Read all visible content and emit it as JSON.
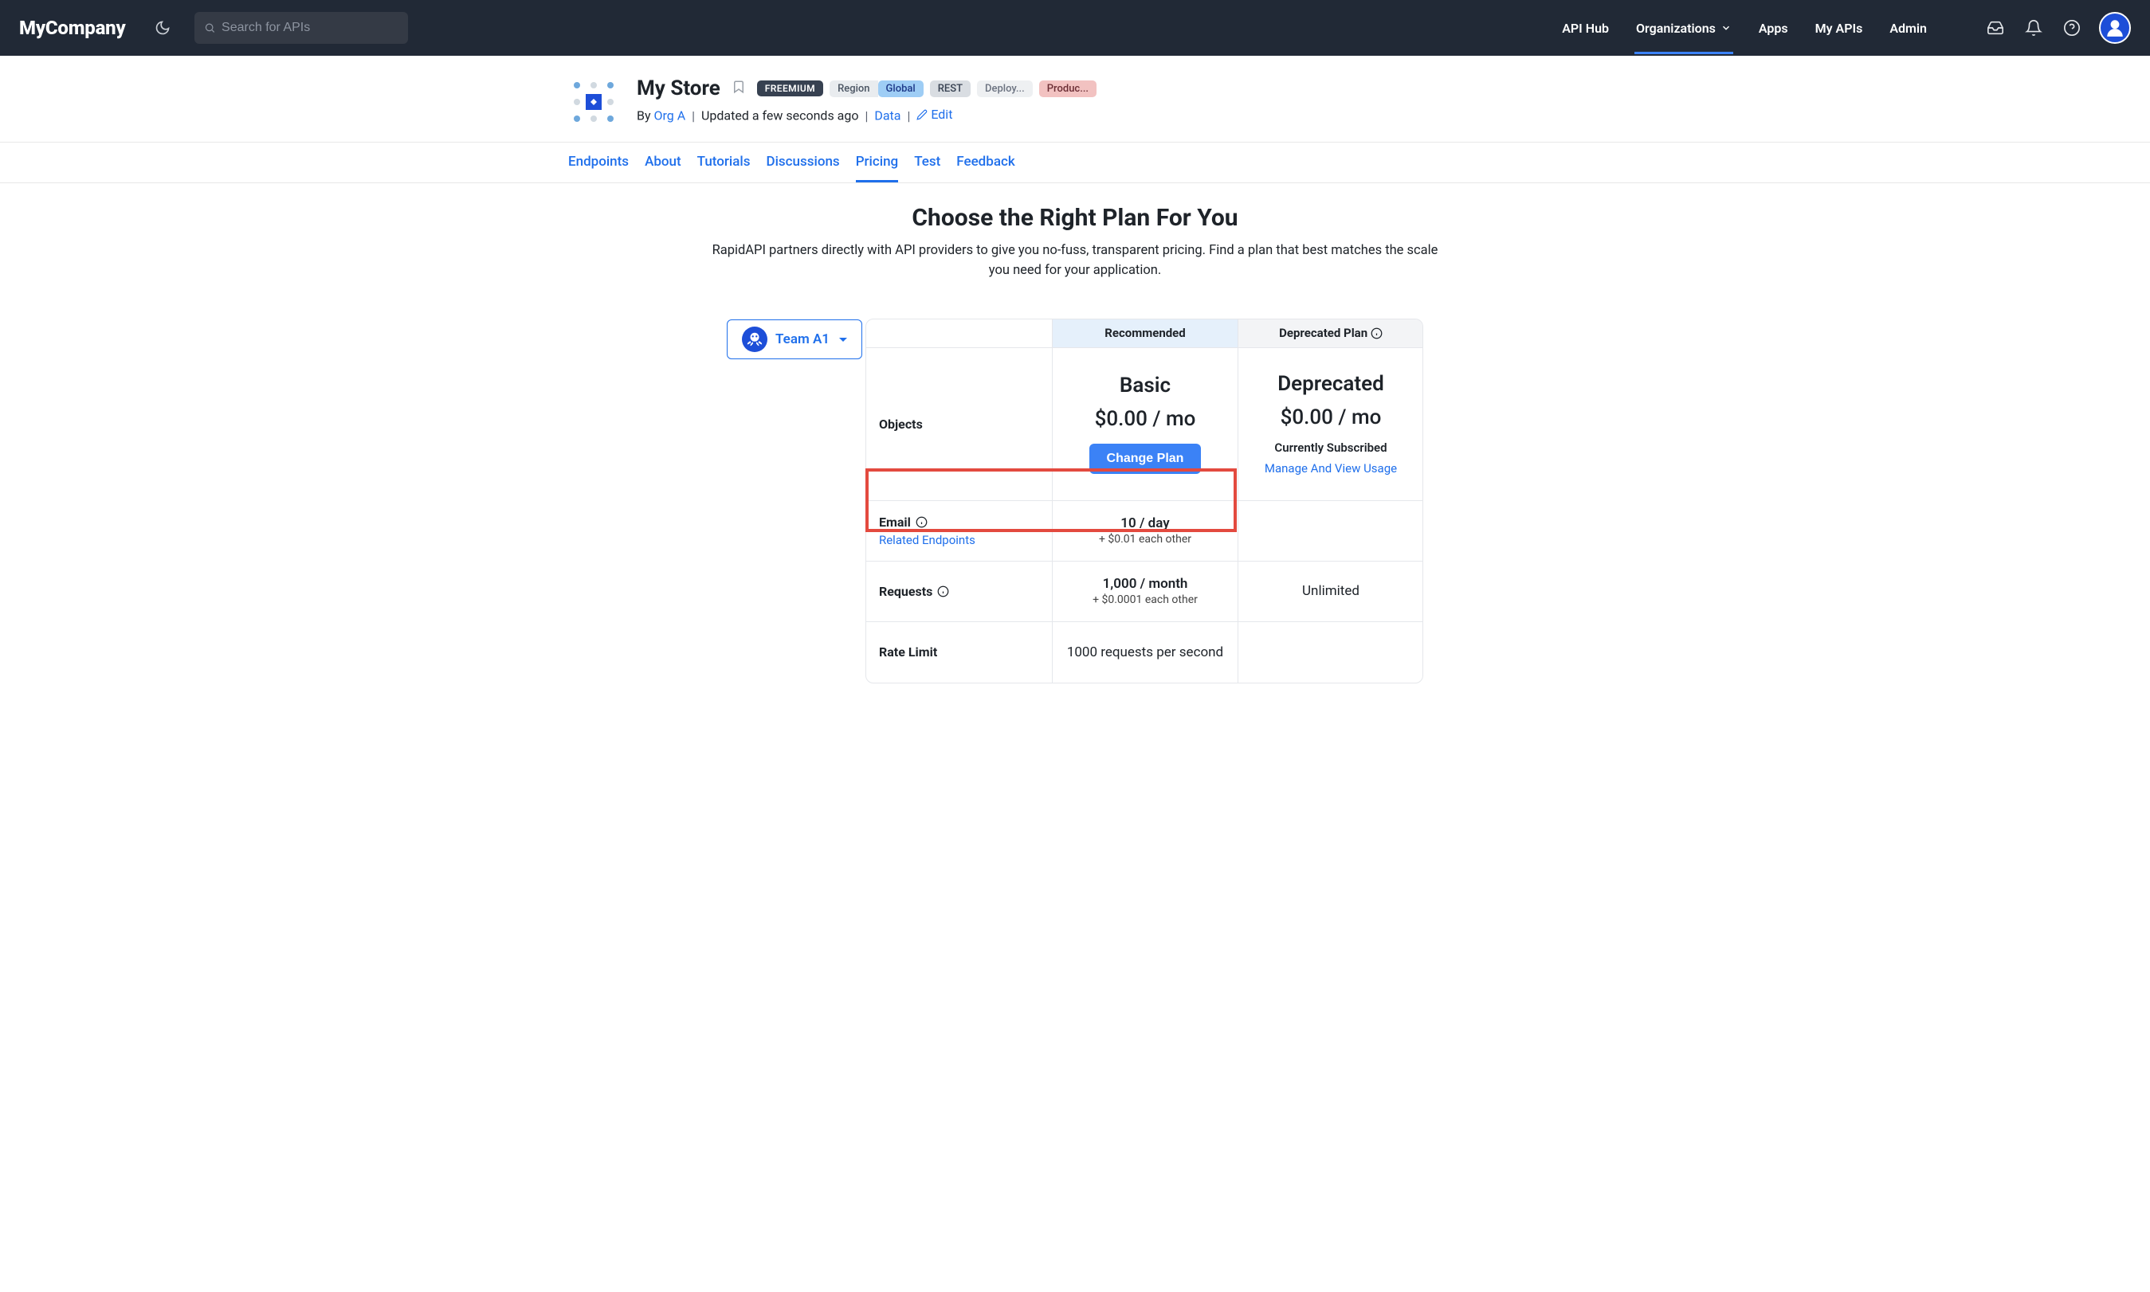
{
  "nav": {
    "brand": "MyCompany",
    "search_placeholder": "Search for APIs",
    "links": [
      "API Hub",
      "Organizations",
      "Apps",
      "My APIs",
      "Admin"
    ],
    "active_index": 1
  },
  "api": {
    "title": "My Store",
    "freemium_badge": "FREEMIUM",
    "region_label": "Region",
    "region_value": "Global",
    "rest_badge": "REST",
    "deploy_badge": "Deploy...",
    "produc_badge": "Produc...",
    "by_label": "By",
    "org_name": "Org A",
    "updated_text": "Updated a few seconds ago",
    "data_link": "Data",
    "edit_link": "Edit"
  },
  "tabs": {
    "items": [
      "Endpoints",
      "About",
      "Tutorials",
      "Discussions",
      "Pricing",
      "Test",
      "Feedback"
    ],
    "active_index": 4
  },
  "pricing": {
    "title": "Choose the Right Plan For You",
    "subtitle": "RapidAPI partners directly with API providers to give you no-fuss, transparent pricing. Find a plan that best matches the scale you need for your application.",
    "team_name": "Team A1",
    "row_labels": {
      "objects": "Objects",
      "email": "Email",
      "related_endpoints": "Related Endpoints",
      "requests": "Requests",
      "rate_limit": "Rate Limit"
    },
    "plans": [
      {
        "header": "Recommended",
        "name": "Basic",
        "price": "$0.00 / mo",
        "cta": "Change Plan",
        "email_quota": "10 / day",
        "email_extra": "+ $0.01 each other",
        "requests_quota": "1,000 / month",
        "requests_extra": "+ $0.0001 each other",
        "rate_limit": "1000 requests per second"
      },
      {
        "header": "Deprecated Plan",
        "name": "Deprecated",
        "price": "$0.00 / mo",
        "status": "Currently Subscribed",
        "manage": "Manage And View Usage",
        "email_quota": "",
        "requests_quota": "Unlimited",
        "rate_limit": ""
      }
    ]
  }
}
